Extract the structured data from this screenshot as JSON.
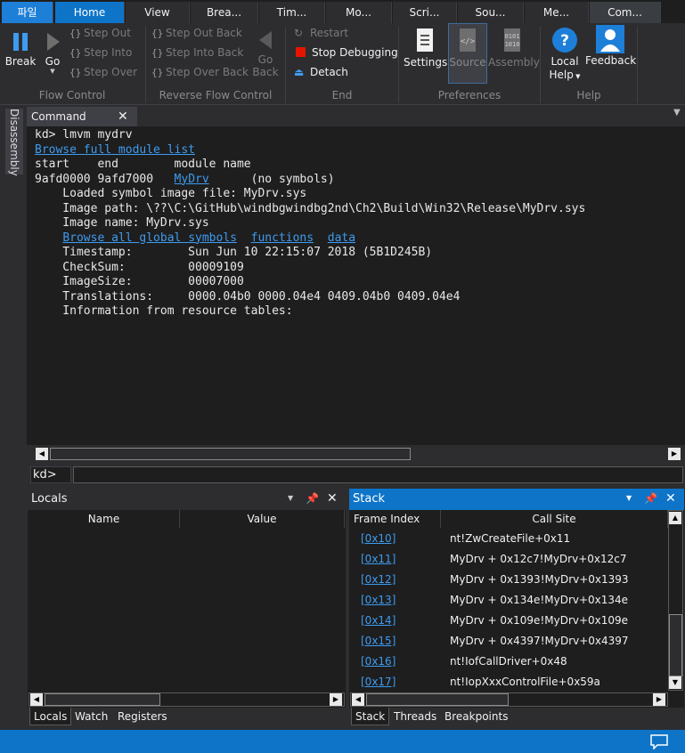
{
  "tabs": [
    {
      "label": "파일",
      "kind": "file"
    },
    {
      "label": "Home",
      "kind": "active"
    },
    {
      "label": "View",
      "kind": ""
    },
    {
      "label": "Brea...",
      "kind": ""
    },
    {
      "label": "Tim...",
      "kind": ""
    },
    {
      "label": "Mo...",
      "kind": ""
    },
    {
      "label": "Scri...",
      "kind": ""
    },
    {
      "label": "Sou...",
      "kind": ""
    },
    {
      "label": "Me...",
      "kind": ""
    },
    {
      "label": "Com...",
      "kind": "lasttab"
    }
  ],
  "ribbon": {
    "break_label": "Break",
    "go_label": "Go",
    "step_out": "Step Out",
    "step_into": "Step Into",
    "step_over": "Step Over",
    "flow_control": "Flow Control",
    "step_out_back": "Step Out Back",
    "step_into_back": "Step Into Back",
    "step_over_back": "Step Over Back",
    "go_back_line1": "Go",
    "go_back_line2": "Back",
    "reverse_flow_control": "Reverse Flow Control",
    "restart": "Restart",
    "stop_debugging": "Stop Debugging",
    "detach": "Detach",
    "end": "End",
    "settings": "Settings",
    "source": "Source",
    "assembly": "Assembly",
    "preferences": "Preferences",
    "local_help_line1": "Local",
    "local_help_line2": "Help",
    "feedback": "Feedback",
    "help": "Help"
  },
  "side": {
    "disassembly": "Disassembly"
  },
  "command": {
    "tab_label": "Command",
    "lines": [
      {
        "text": "kd> lmvm mydrv"
      },
      {
        "link": "Browse full module list"
      },
      {
        "text": "start    end        module name"
      },
      {
        "pre": "9afd0000 9afd7000   ",
        "link": "MyDrv",
        "post": "      (no symbols)"
      },
      {
        "text": "    Loaded symbol image file: MyDrv.sys"
      },
      {
        "text": "    Image path: \\??\\C:\\GitHub\\windbgwindbg2nd\\Ch2\\Build\\Win32\\Release\\MyDrv.sys"
      },
      {
        "text": "    Image name: MyDrv.sys"
      },
      {
        "pre": "    ",
        "link": "Browse all global symbols",
        "mid1": "  ",
        "link2": "functions",
        "mid2": "  ",
        "link3": "data"
      },
      {
        "text": "    Timestamp:        Sun Jun 10 22:15:07 2018 (5B1D245B)"
      },
      {
        "text": "    CheckSum:         00009109"
      },
      {
        "text": "    ImageSize:        00007000"
      },
      {
        "text": "    Translations:     0000.04b0 0000.04e4 0409.04b0 0409.04e4"
      },
      {
        "text": "    Information from resource tables:"
      }
    ],
    "prompt": "kd>"
  },
  "locals": {
    "title": "Locals",
    "col_name": "Name",
    "col_value": "Value",
    "tabs": [
      "Locals",
      "Watch",
      "Registers"
    ]
  },
  "stack": {
    "title": "Stack",
    "col_frame": "Frame Index",
    "col_call": "Call Site",
    "rows": [
      {
        "frame": "[0x10]",
        "call": "nt!ZwCreateFile+0x11"
      },
      {
        "frame": "[0x11]",
        "call": "MyDrv + 0x12c7!MyDrv+0x12c7"
      },
      {
        "frame": "[0x12]",
        "call": "MyDrv + 0x1393!MyDrv+0x1393"
      },
      {
        "frame": "[0x13]",
        "call": "MyDrv + 0x134e!MyDrv+0x134e"
      },
      {
        "frame": "[0x14]",
        "call": "MyDrv + 0x109e!MyDrv+0x109e"
      },
      {
        "frame": "[0x15]",
        "call": "MyDrv + 0x4397!MyDrv+0x4397"
      },
      {
        "frame": "[0x16]",
        "call": "nt!IofCallDriver+0x48"
      },
      {
        "frame": "[0x17]",
        "call": "nt!IopXxxControlFile+0x59a"
      }
    ],
    "tabs": [
      "Stack",
      "Threads",
      "Breakpoints"
    ]
  },
  "colors": {
    "accent": "#0e74c8",
    "link": "#3e9bf0",
    "stop": "#e51400"
  }
}
